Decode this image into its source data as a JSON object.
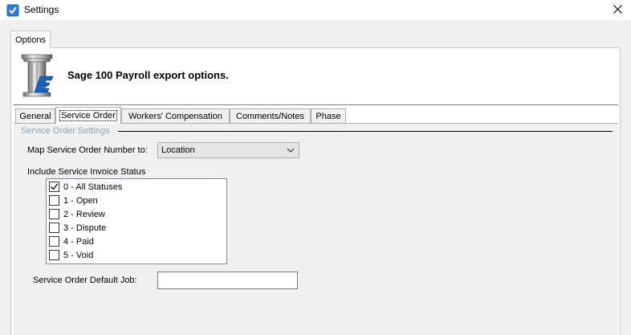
{
  "window": {
    "title": "Settings",
    "app_icon": "checkbox-app-icon",
    "close_icon": "close-icon"
  },
  "outer_tab": {
    "label": "Options"
  },
  "header": {
    "title": "Sage 100 Payroll export options.",
    "logo": "column-logo-icon"
  },
  "tabs": [
    {
      "label": "General"
    },
    {
      "label": "Service Order",
      "active": true
    },
    {
      "label": "Workers' Compensation"
    },
    {
      "label": "Comments/Notes"
    },
    {
      "label": "Phase"
    }
  ],
  "group": {
    "title": "Service Order Settings"
  },
  "map_field": {
    "label": "Map Service Order Number to:",
    "value": "Location"
  },
  "status_list": {
    "label": "Include Service Invoice Status",
    "items": [
      {
        "label": "0 - All Statuses",
        "checked": true
      },
      {
        "label": "1 - Open",
        "checked": false
      },
      {
        "label": "2 - Review",
        "checked": false
      },
      {
        "label": "3 - Dispute",
        "checked": false
      },
      {
        "label": "4 - Paid",
        "checked": false
      },
      {
        "label": "5 - Void",
        "checked": false
      }
    ]
  },
  "default_job": {
    "label": "Service Order Default Job:",
    "value": ""
  },
  "colors": {
    "group_title": "#8aa4be",
    "logo_accent": "#1565c0"
  }
}
